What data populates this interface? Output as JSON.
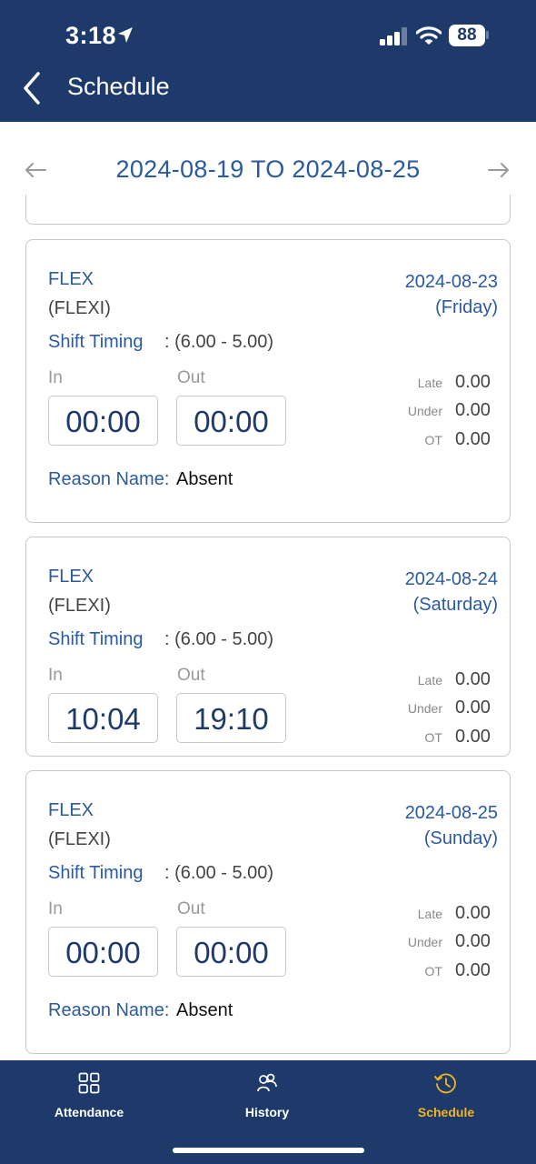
{
  "status_bar": {
    "time": "3:18",
    "battery": "88"
  },
  "header": {
    "title": "Schedule",
    "back_icon": "chevron-left-icon"
  },
  "week_nav": {
    "range": "2024-08-19 TO 2024-08-25",
    "prev_icon": "arrow-left-icon",
    "next_icon": "arrow-right-icon"
  },
  "labels": {
    "shift_timing": "Shift Timing",
    "in": "In",
    "out": "Out",
    "late": "Late",
    "under": "Under",
    "ot": "OT",
    "reason_name": "Reason Name:"
  },
  "cards": [
    {
      "shift_name": "FLEX",
      "shift_code": "(FLEXI)",
      "date": "2024-08-23",
      "day": "(Friday)",
      "timing": ": (6.00 - 5.00)",
      "time_in": "00:00",
      "time_out": "00:00",
      "late": "0.00",
      "under": "0.00",
      "ot": "0.00",
      "reason": "Absent"
    },
    {
      "shift_name": "FLEX",
      "shift_code": "(FLEXI)",
      "date": "2024-08-24",
      "day": "(Saturday)",
      "timing": ": (6.00 - 5.00)",
      "time_in": "10:04",
      "time_out": "19:10",
      "late": "0.00",
      "under": "0.00",
      "ot": "0.00"
    },
    {
      "shift_name": "FLEX",
      "shift_code": "(FLEXI)",
      "date": "2024-08-25",
      "day": "(Sunday)",
      "timing": ": (6.00 - 5.00)",
      "time_in": "00:00",
      "time_out": "00:00",
      "late": "0.00",
      "under": "0.00",
      "ot": "0.00",
      "reason": "Absent"
    }
  ],
  "bottom_nav": [
    {
      "label": "Attendance",
      "icon": "grid-icon"
    },
    {
      "label": "History",
      "icon": "people-icon"
    },
    {
      "label": "Schedule",
      "icon": "clock-history-icon",
      "active": true
    }
  ],
  "colors": {
    "primary": "#1e3a6b",
    "accent_text": "#2a5aa0",
    "active_tab": "#f2b51e",
    "border": "#c8c8c8"
  }
}
